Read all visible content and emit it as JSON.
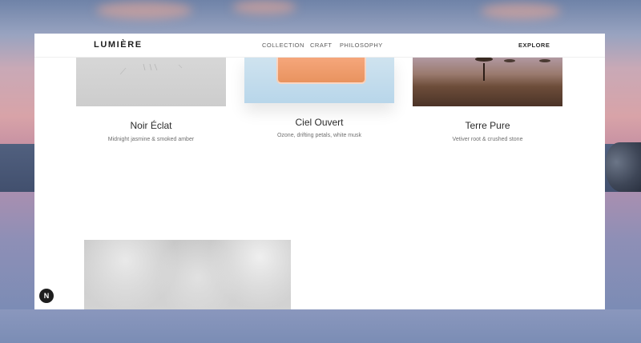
{
  "brand": {
    "logo": "LUMIÈRE"
  },
  "nav": {
    "links": [
      {
        "label": "COLLECTION"
      },
      {
        "label": "CRAFT"
      },
      {
        "label": "PHILOSOPHY"
      }
    ],
    "cta": "EXPLORE"
  },
  "collection": {
    "items": [
      {
        "title": "Noir Éclat",
        "description": "Midnight jasmine & smoked amber"
      },
      {
        "title": "Ciel Ouvert",
        "description": "Ozone, drifting petals, white musk"
      },
      {
        "title": "Terre Pure",
        "description": "Vetiver root & crushed stone"
      }
    ]
  },
  "badge": {
    "letter": "N"
  },
  "colors": {
    "text_primary": "#2b2b2b",
    "text_muted": "#707070",
    "ciel_bottle": "#e8935f",
    "badge_bg": "#1e1e1e"
  }
}
